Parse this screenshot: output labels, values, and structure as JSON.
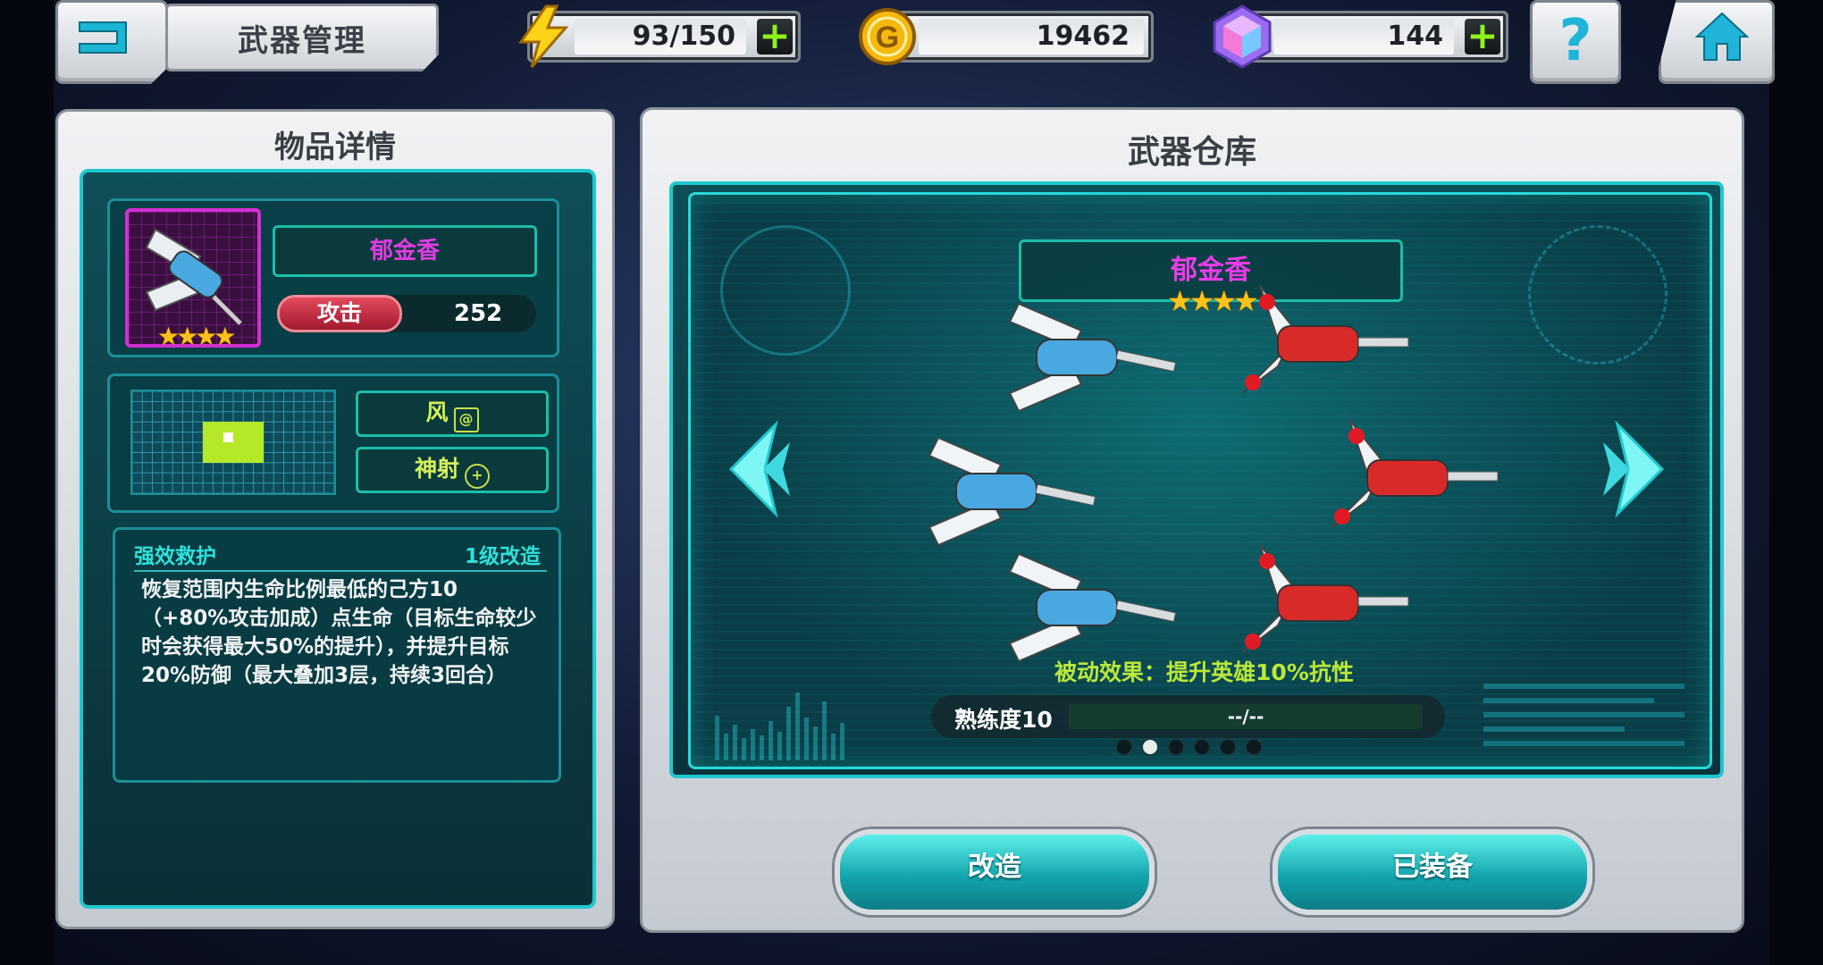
{
  "top_bar": {
    "title": "武器管理",
    "energy": "93/150",
    "gold": "19462",
    "gems": "144",
    "help_symbol": "?"
  },
  "detail_panel": {
    "title": "物品详情",
    "weapon_name": "郁金香",
    "stars": "★★★★",
    "attack_label": "攻击",
    "attack_value": "252",
    "tag_element": "风",
    "tag_class": "神射",
    "skill_name": "强效救护",
    "skill_level": "1级改造",
    "skill_desc": "恢复范围内生命比例最低的己方10（+80%攻击加成）点生命（目标生命较少时会获得最大50%的提升），并提升目标20%防御（最大叠加3层，持续3回合）"
  },
  "warehouse_panel": {
    "title": "武器仓库",
    "weapon_name": "郁金香",
    "stars": "★★★★",
    "passive": "被动效果：提升英雄10%抗性",
    "mastery_label": "熟练度10",
    "mastery_value": "--/--",
    "page_count": 6,
    "active_page": 2,
    "modify_button": "改造",
    "equipped_button": "已装备"
  },
  "colors": {
    "accent_cyan": "#1fc8cf",
    "name_magenta": "#e03ce3",
    "attack_red": "#c62a40",
    "star_gold": "#ffc21a",
    "plus_green": "#8ef21c"
  },
  "icons": [
    "back-icon",
    "lightning-icon",
    "gold-coin-icon",
    "gem-icon",
    "plus-icon",
    "help-icon",
    "home-icon",
    "wind-icon",
    "crosshair-icon",
    "arrow-left-icon",
    "arrow-right-icon"
  ]
}
